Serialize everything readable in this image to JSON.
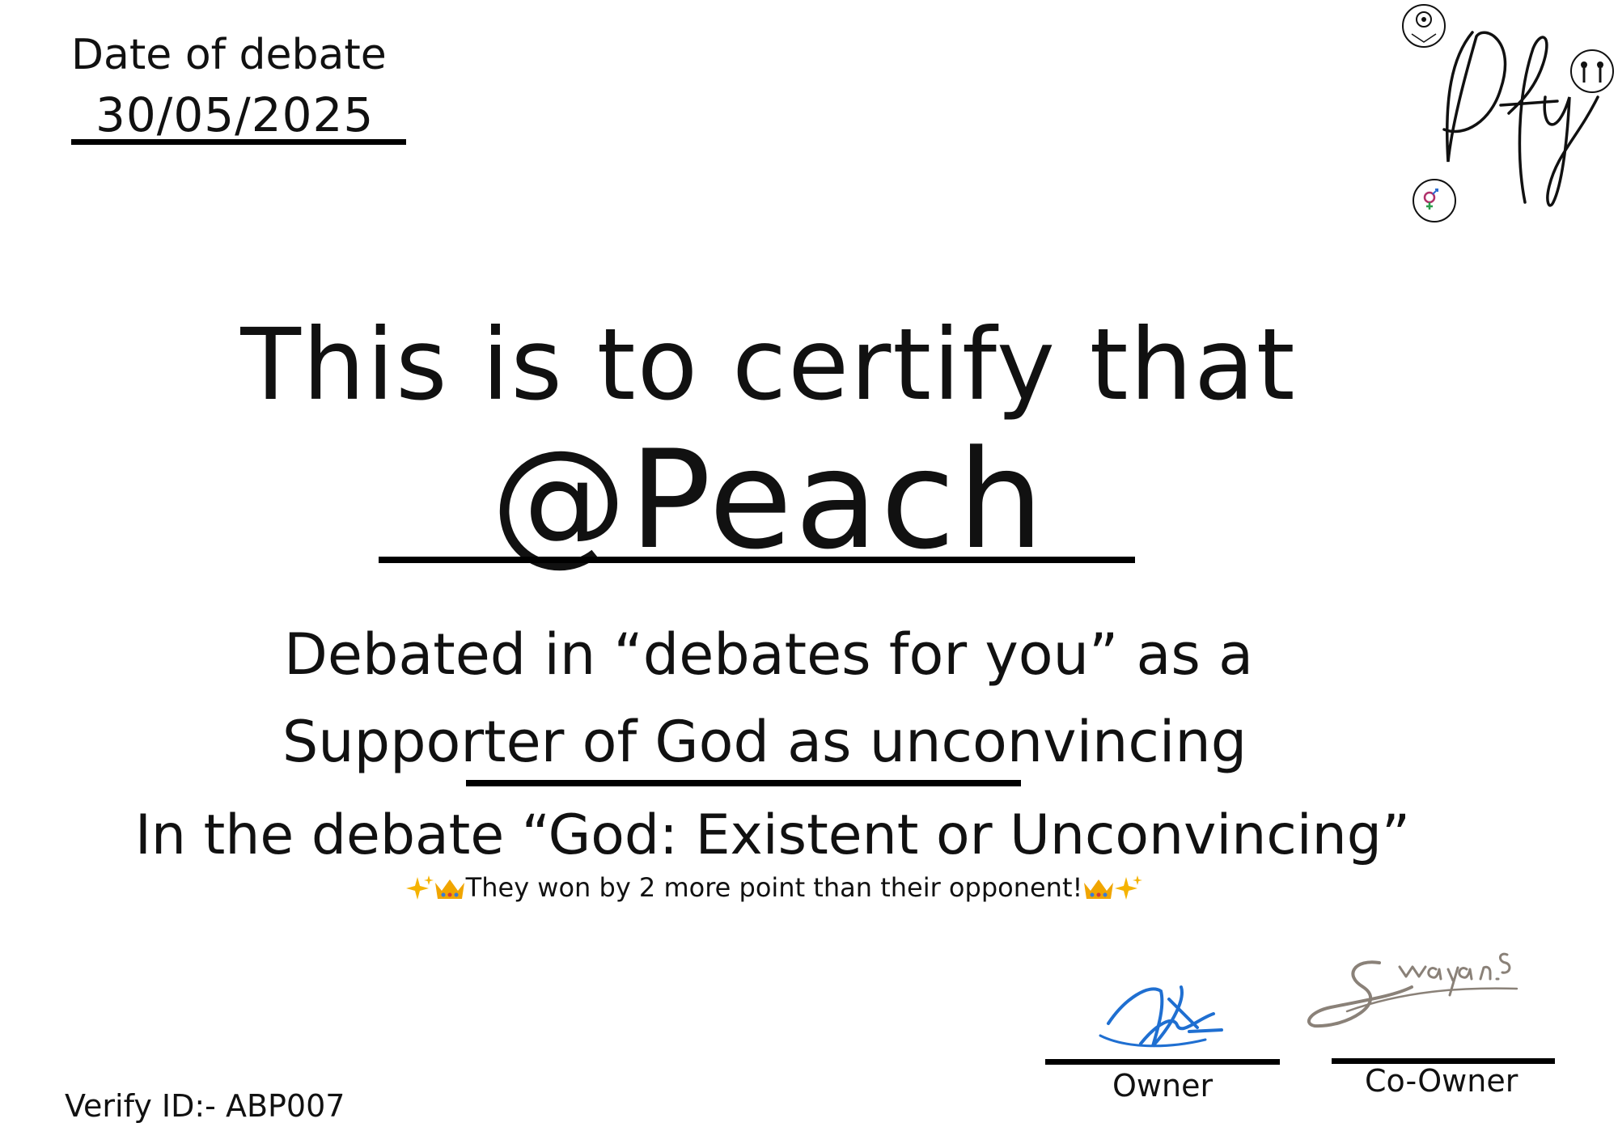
{
  "date": {
    "label": "Date of debate",
    "value": "30/05/2025"
  },
  "logo": {
    "text": "Dfy"
  },
  "certificate": {
    "heading": "This is to certify that",
    "name": "@Peach",
    "line1": "Debated in “debates for you” as a",
    "line2": "Supporter of God as unconvincing",
    "line3": "In the debate “God: Existent or Unconvincing”",
    "win_text": "They won by 2 more point than their opponent!"
  },
  "signatures": {
    "owner_label": "Owner",
    "coowner_label": "Co-Owner",
    "coowner_signature": "Swayan.S"
  },
  "verify": {
    "text": "Verify ID:- ABP007"
  },
  "colors": {
    "ink": "#111111",
    "owner_signature": "#1f6fd1",
    "coowner_signature": "#8a8178",
    "sparkle": "#f5b301",
    "crown": "#f0a500"
  }
}
